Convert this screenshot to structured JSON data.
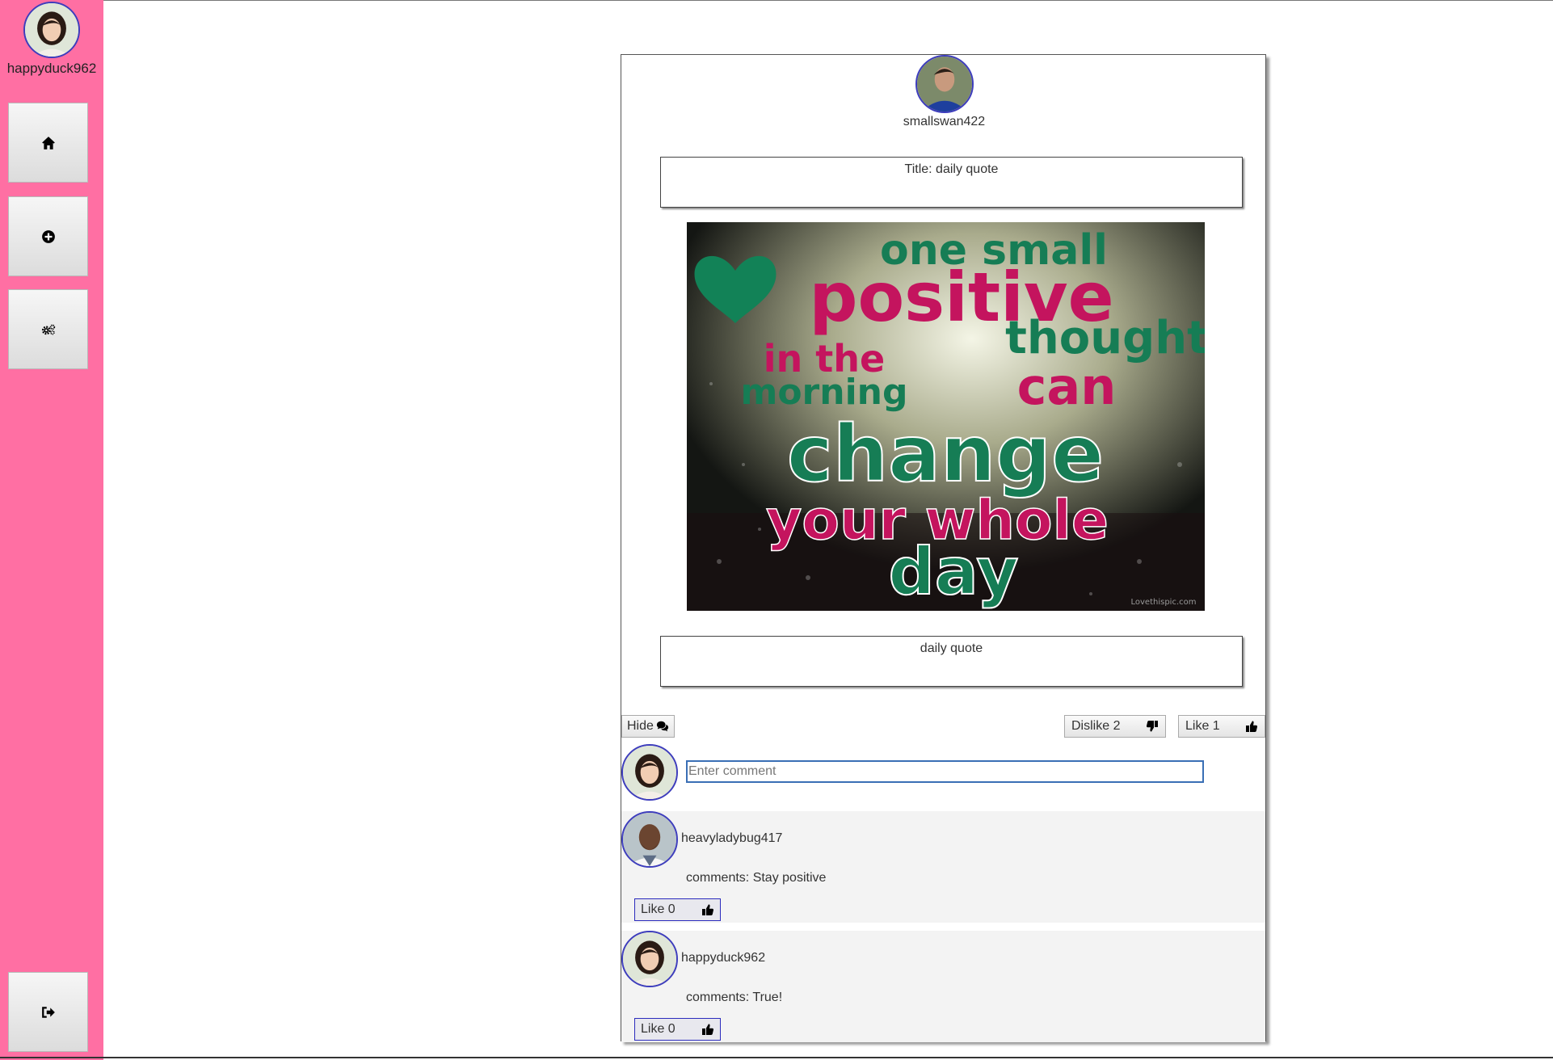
{
  "sidebar": {
    "username": "happyduck962",
    "buttons": [
      {
        "name": "home",
        "icon": "home-icon"
      },
      {
        "name": "create-post",
        "icon": "plus-circle-icon"
      },
      {
        "name": "settings",
        "icon": "gears-icon"
      },
      {
        "name": "logout",
        "icon": "sign-out-icon"
      }
    ],
    "background_color": "#ff6fa3"
  },
  "post": {
    "author": "smallswan422",
    "title": "Title: daily quote",
    "image_text": [
      "one small",
      "positive",
      "thought",
      "in the",
      "morning",
      "can",
      "change",
      "your whole",
      "day"
    ],
    "image_watermark": "Lovethispic.com",
    "description": "daily quote",
    "hide_label": "Hide",
    "dislike_label": "Dislike 2",
    "like_label": "Like 1"
  },
  "comment_input": {
    "placeholder": "Enter comment"
  },
  "comments": [
    {
      "user": "heavyladybug417",
      "text": "comments: Stay positive",
      "like_label": "Like 0"
    },
    {
      "user": "happyduck962",
      "text": "comments: True!",
      "like_label": "Like 0"
    }
  ]
}
